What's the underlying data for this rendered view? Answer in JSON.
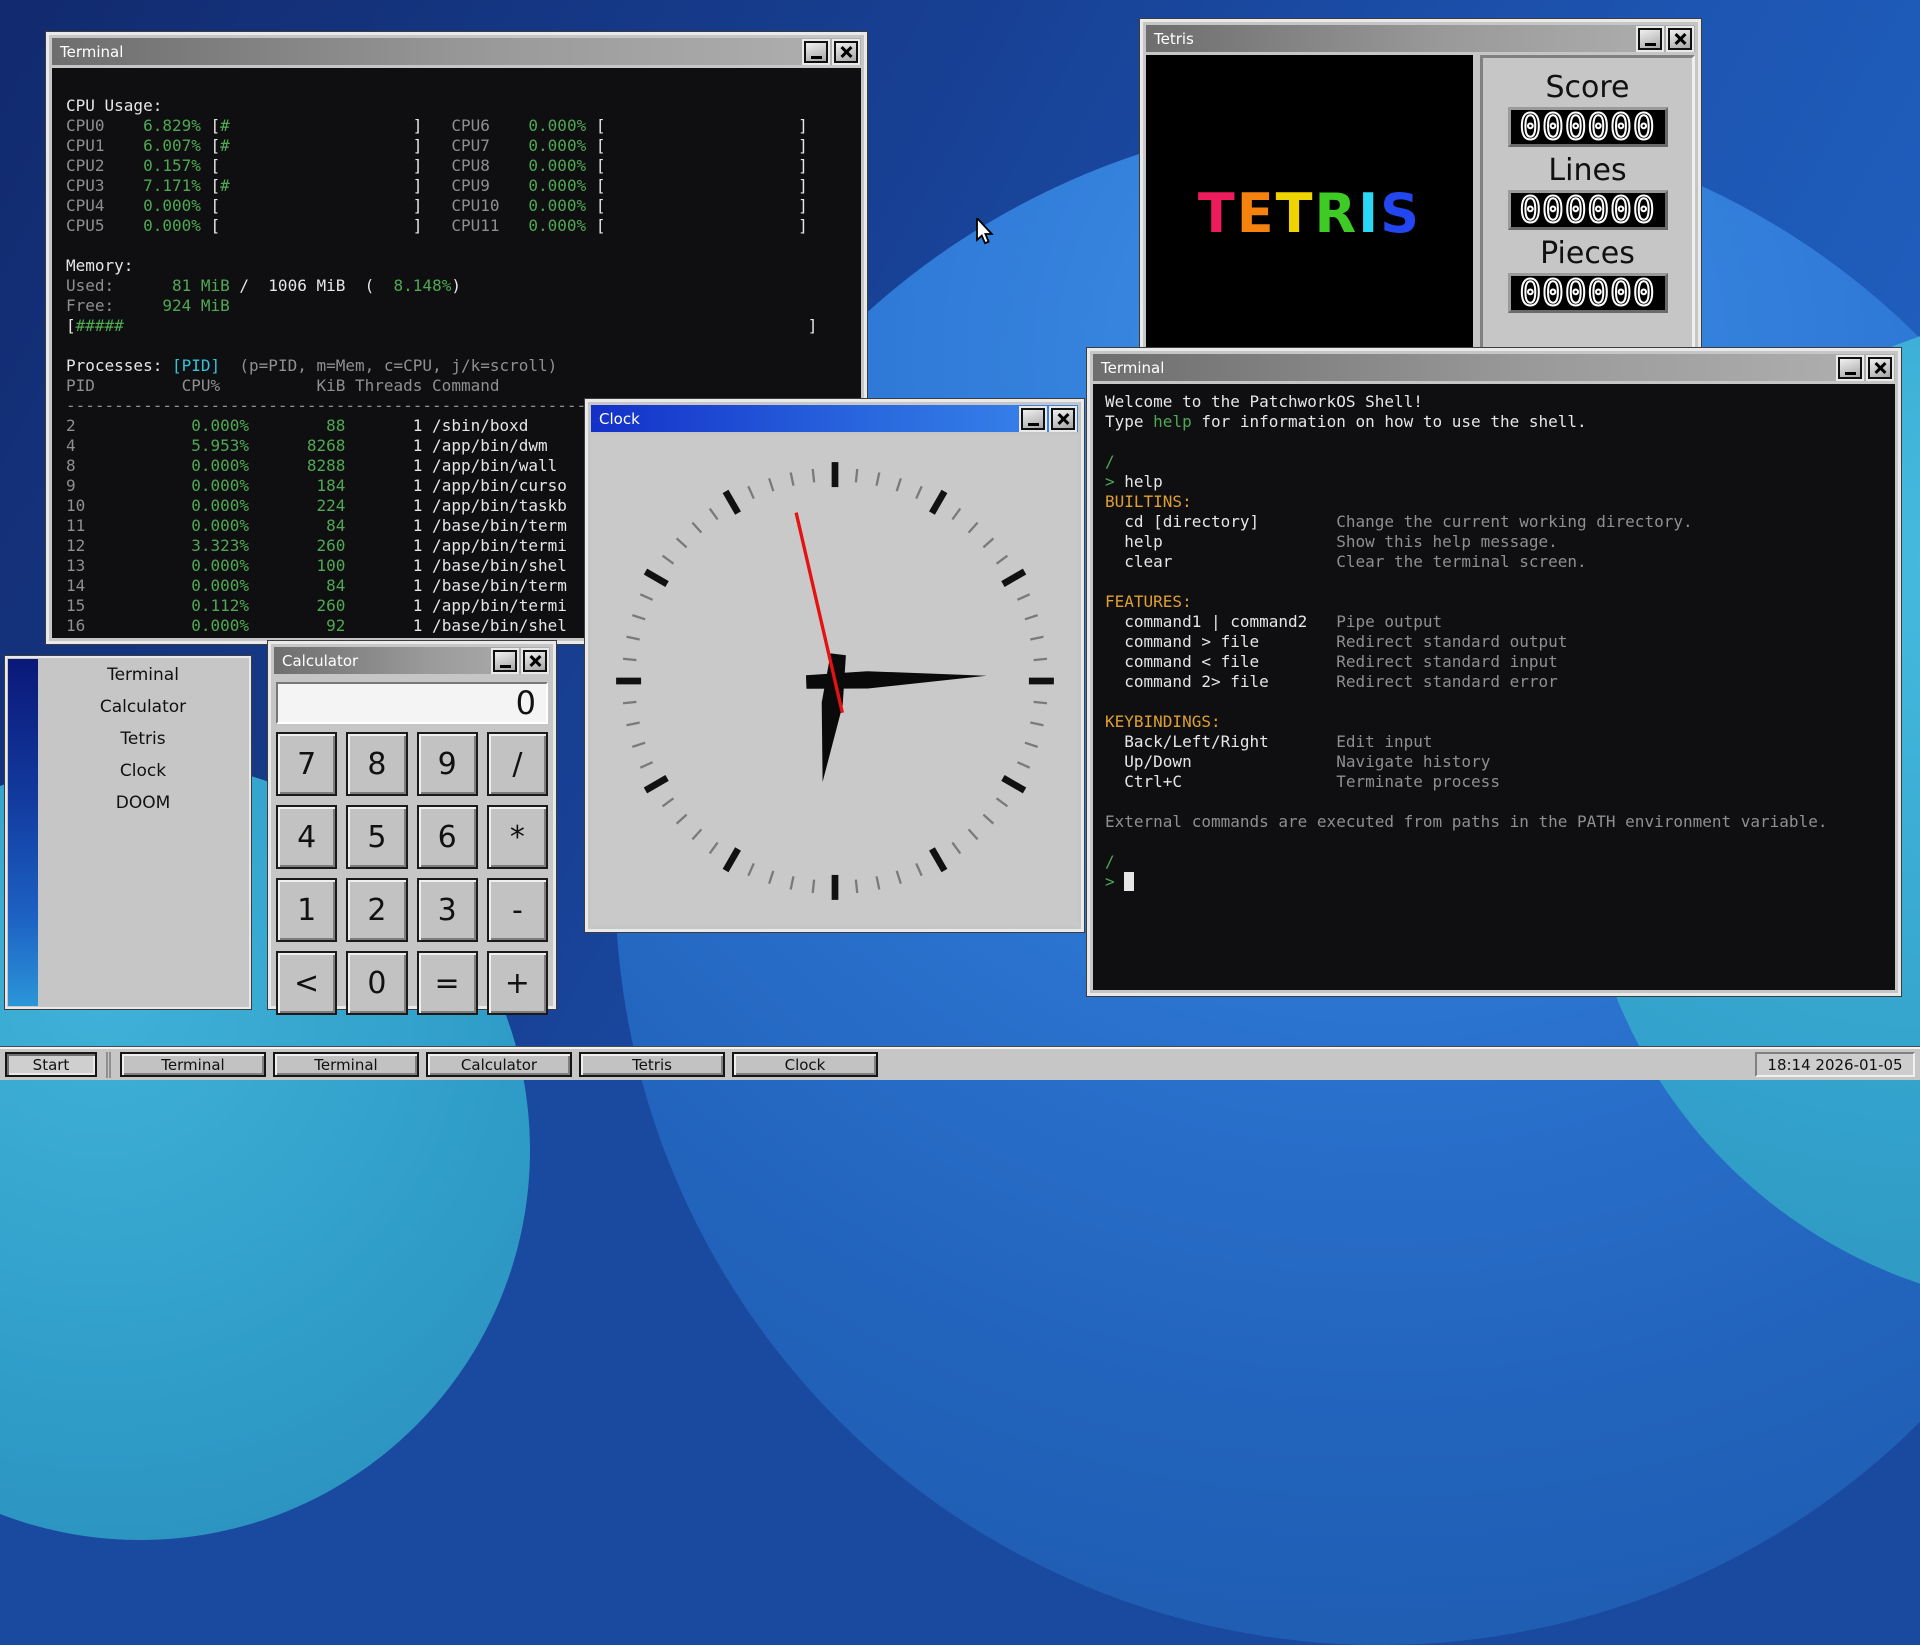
{
  "colors": {
    "terminal_green": "#4fa852",
    "terminal_orange": "#dfa02f",
    "terminal_cyan": "#30c5da",
    "terminal_gray": "#8f8f8f",
    "active_titlebar_blue": "#2a6ae0",
    "second_hand_red": "#e51212"
  },
  "windows": {
    "terminal1": {
      "title": "Terminal",
      "lines": [
        [
          {
            "t": "CPU Usage:"
          }
        ],
        [
          {
            "t": "CPU0    ",
            "c": "g"
          },
          {
            "t": "6.829% ",
            "c": "n"
          },
          {
            "t": "["
          },
          {
            "t": "#",
            "c": "n"
          },
          {
            "t": "                   ]   "
          },
          {
            "t": "CPU6    ",
            "c": "g"
          },
          {
            "t": "0.000% ",
            "c": "n"
          },
          {
            "t": "[                    ]"
          }
        ],
        [
          {
            "t": "CPU1    ",
            "c": "g"
          },
          {
            "t": "6.007% ",
            "c": "n"
          },
          {
            "t": "["
          },
          {
            "t": "#",
            "c": "n"
          },
          {
            "t": "                   ]   "
          },
          {
            "t": "CPU7    ",
            "c": "g"
          },
          {
            "t": "0.000% ",
            "c": "n"
          },
          {
            "t": "[                    ]"
          }
        ],
        [
          {
            "t": "CPU2    ",
            "c": "g"
          },
          {
            "t": "0.157% ",
            "c": "n"
          },
          {
            "t": "[                    ]   "
          },
          {
            "t": "CPU8    ",
            "c": "g"
          },
          {
            "t": "0.000% ",
            "c": "n"
          },
          {
            "t": "[                    ]"
          }
        ],
        [
          {
            "t": "CPU3    ",
            "c": "g"
          },
          {
            "t": "7.171% ",
            "c": "n"
          },
          {
            "t": "["
          },
          {
            "t": "#",
            "c": "n"
          },
          {
            "t": "                   ]   "
          },
          {
            "t": "CPU9    ",
            "c": "g"
          },
          {
            "t": "0.000% ",
            "c": "n"
          },
          {
            "t": "[                    ]"
          }
        ],
        [
          {
            "t": "CPU4    ",
            "c": "g"
          },
          {
            "t": "0.000% ",
            "c": "n"
          },
          {
            "t": "[                    ]   "
          },
          {
            "t": "CPU10   ",
            "c": "g"
          },
          {
            "t": "0.000% ",
            "c": "n"
          },
          {
            "t": "[                    ]"
          }
        ],
        [
          {
            "t": "CPU5    ",
            "c": "g"
          },
          {
            "t": "0.000% ",
            "c": "n"
          },
          {
            "t": "[                    ]   "
          },
          {
            "t": "CPU11   ",
            "c": "g"
          },
          {
            "t": "0.000% ",
            "c": "n"
          },
          {
            "t": "[                    ]"
          }
        ],
        [],
        [
          {
            "t": "Memory:"
          }
        ],
        [
          {
            "t": "Used:      ",
            "c": "g"
          },
          {
            "t": "81 MiB",
            "c": "n"
          },
          {
            "t": " /  "
          },
          {
            "t": "1006 MiB"
          },
          {
            "t": "  (  "
          },
          {
            "t": "8.148%",
            "c": "n"
          },
          {
            "t": ")"
          }
        ],
        [
          {
            "t": "Free:     ",
            "c": "g"
          },
          {
            "t": "924 MiB",
            "c": "n"
          }
        ],
        [
          {
            "t": "["
          },
          {
            "t": "#####",
            "c": "n"
          },
          {
            "t": "                                                                       ]"
          }
        ],
        [],
        [
          {
            "t": "Processes: "
          },
          {
            "t": "[PID]",
            "c": "c2"
          },
          {
            "t": "  "
          },
          {
            "t": "(p=PID, m=Mem, c=CPU, j/k=scroll)",
            "c": "g"
          }
        ],
        [
          {
            "t": "PID         CPU%          KiB Threads Command",
            "c": "g"
          }
        ],
        [
          {
            "t": "------------------------------------------------------------",
            "c": "g"
          }
        ],
        [
          {
            "t": "2            ",
            "c": "g"
          },
          {
            "t": "0.000%",
            "c": "n"
          },
          {
            "t": "        88",
            "c": "n"
          },
          {
            "t": "       1 /sbin/boxd"
          }
        ],
        [
          {
            "t": "4            ",
            "c": "g"
          },
          {
            "t": "5.953%",
            "c": "n"
          },
          {
            "t": "      8268",
            "c": "n"
          },
          {
            "t": "       1 /app/bin/dwm"
          }
        ],
        [
          {
            "t": "8            ",
            "c": "g"
          },
          {
            "t": "0.000%",
            "c": "n"
          },
          {
            "t": "      8288",
            "c": "n"
          },
          {
            "t": "       1 /app/bin/wall"
          }
        ],
        [
          {
            "t": "9            ",
            "c": "g"
          },
          {
            "t": "0.000%",
            "c": "n"
          },
          {
            "t": "       184",
            "c": "n"
          },
          {
            "t": "       1 /app/bin/curso"
          }
        ],
        [
          {
            "t": "10           ",
            "c": "g"
          },
          {
            "t": "0.000%",
            "c": "n"
          },
          {
            "t": "       224",
            "c": "n"
          },
          {
            "t": "       1 /app/bin/taskb"
          }
        ],
        [
          {
            "t": "11           ",
            "c": "g"
          },
          {
            "t": "0.000%",
            "c": "n"
          },
          {
            "t": "        84",
            "c": "n"
          },
          {
            "t": "       1 /base/bin/term"
          }
        ],
        [
          {
            "t": "12           ",
            "c": "g"
          },
          {
            "t": "3.323%",
            "c": "n"
          },
          {
            "t": "       260",
            "c": "n"
          },
          {
            "t": "       1 /app/bin/termi"
          }
        ],
        [
          {
            "t": "13           ",
            "c": "g"
          },
          {
            "t": "0.000%",
            "c": "n"
          },
          {
            "t": "       100",
            "c": "n"
          },
          {
            "t": "       1 /base/bin/shel"
          }
        ],
        [
          {
            "t": "14           ",
            "c": "g"
          },
          {
            "t": "0.000%",
            "c": "n"
          },
          {
            "t": "        84",
            "c": "n"
          },
          {
            "t": "       1 /base/bin/term"
          }
        ],
        [
          {
            "t": "15           ",
            "c": "g"
          },
          {
            "t": "0.112%",
            "c": "n"
          },
          {
            "t": "       260",
            "c": "n"
          },
          {
            "t": "       1 /app/bin/termi"
          }
        ],
        [
          {
            "t": "16           ",
            "c": "g"
          },
          {
            "t": "0.000%",
            "c": "n"
          },
          {
            "t": "        92",
            "c": "n"
          },
          {
            "t": "       1 /base/bin/shel"
          }
        ]
      ]
    },
    "terminal2": {
      "title": "Terminal",
      "lines": [
        [
          {
            "t": "Welcome to the PatchworkOS Shell!"
          }
        ],
        [
          {
            "t": "Type "
          },
          {
            "t": "help",
            "c": "n"
          },
          {
            "t": " for information on how to use the shell."
          }
        ],
        [],
        [
          {
            "t": "/",
            "c": "n"
          }
        ],
        [
          {
            "t": "> ",
            "c": "n"
          },
          {
            "t": "help"
          }
        ],
        [
          {
            "t": "BUILTINS:",
            "c": "o"
          }
        ],
        [
          {
            "t": "  cd [directory]"
          },
          {
            "t": "        "
          },
          {
            "t": "Change the current working directory.",
            "c": "g"
          }
        ],
        [
          {
            "t": "  help"
          },
          {
            "t": "                  "
          },
          {
            "t": "Show this help message.",
            "c": "g"
          }
        ],
        [
          {
            "t": "  clear"
          },
          {
            "t": "                 "
          },
          {
            "t": "Clear the terminal screen.",
            "c": "g"
          }
        ],
        [],
        [
          {
            "t": "FEATURES:",
            "c": "o"
          }
        ],
        [
          {
            "t": "  command1 | command2"
          },
          {
            "t": "   "
          },
          {
            "t": "Pipe output",
            "c": "g"
          }
        ],
        [
          {
            "t": "  command > file"
          },
          {
            "t": "        "
          },
          {
            "t": "Redirect standard output",
            "c": "g"
          }
        ],
        [
          {
            "t": "  command < file"
          },
          {
            "t": "        "
          },
          {
            "t": "Redirect standard input",
            "c": "g"
          }
        ],
        [
          {
            "t": "  command 2> file"
          },
          {
            "t": "       "
          },
          {
            "t": "Redirect standard error",
            "c": "g"
          }
        ],
        [],
        [
          {
            "t": "KEYBINDINGS:",
            "c": "o"
          }
        ],
        [
          {
            "t": "  Back/Left/Right"
          },
          {
            "t": "       "
          },
          {
            "t": "Edit input",
            "c": "g"
          }
        ],
        [
          {
            "t": "  Up/Down"
          },
          {
            "t": "               "
          },
          {
            "t": "Navigate history",
            "c": "g"
          }
        ],
        [
          {
            "t": "  Ctrl+C"
          },
          {
            "t": "                "
          },
          {
            "t": "Terminate process",
            "c": "g"
          }
        ],
        [],
        [
          {
            "t": "External commands are executed from paths in the PATH environment variable.",
            "c": "g"
          }
        ],
        [],
        [
          {
            "t": "/",
            "c": "n"
          }
        ],
        [
          {
            "t": "> ",
            "c": "n"
          },
          {
            "t": " ",
            "c": "cur"
          }
        ]
      ]
    },
    "tetris": {
      "title": "Tetris",
      "logo": [
        {
          "ch": "T",
          "color": "#ed1c5c"
        },
        {
          "ch": "E",
          "color": "#f5820f"
        },
        {
          "ch": "T",
          "color": "#f0d400"
        },
        {
          "ch": "R",
          "color": "#3ecb26"
        },
        {
          "ch": "I",
          "color": "#29d8f5"
        },
        {
          "ch": "S",
          "color": "#2246f0"
        }
      ],
      "stats": [
        {
          "label": "Score",
          "value": "000000"
        },
        {
          "label": "Lines",
          "value": "000000"
        },
        {
          "label": "Pieces",
          "value": "000000"
        }
      ]
    },
    "clock": {
      "title": "Clock",
      "hands": {
        "hour_deg": 187,
        "minute_deg": 88,
        "second_deg": 347
      }
    },
    "calculator": {
      "title": "Calculator",
      "display": "0",
      "keys": [
        "7",
        "8",
        "9",
        "/",
        "4",
        "5",
        "6",
        "*",
        "1",
        "2",
        "3",
        "-",
        "<",
        "0",
        "=",
        "+"
      ]
    }
  },
  "start_menu": {
    "items": [
      "Terminal",
      "Calculator",
      "Tetris",
      "Clock",
      "DOOM"
    ]
  },
  "taskbar": {
    "start_label": "Start",
    "window_buttons": [
      "Terminal",
      "Terminal",
      "Calculator",
      "Tetris",
      "Clock"
    ],
    "clock_text": "18:14 2026-01-05"
  }
}
